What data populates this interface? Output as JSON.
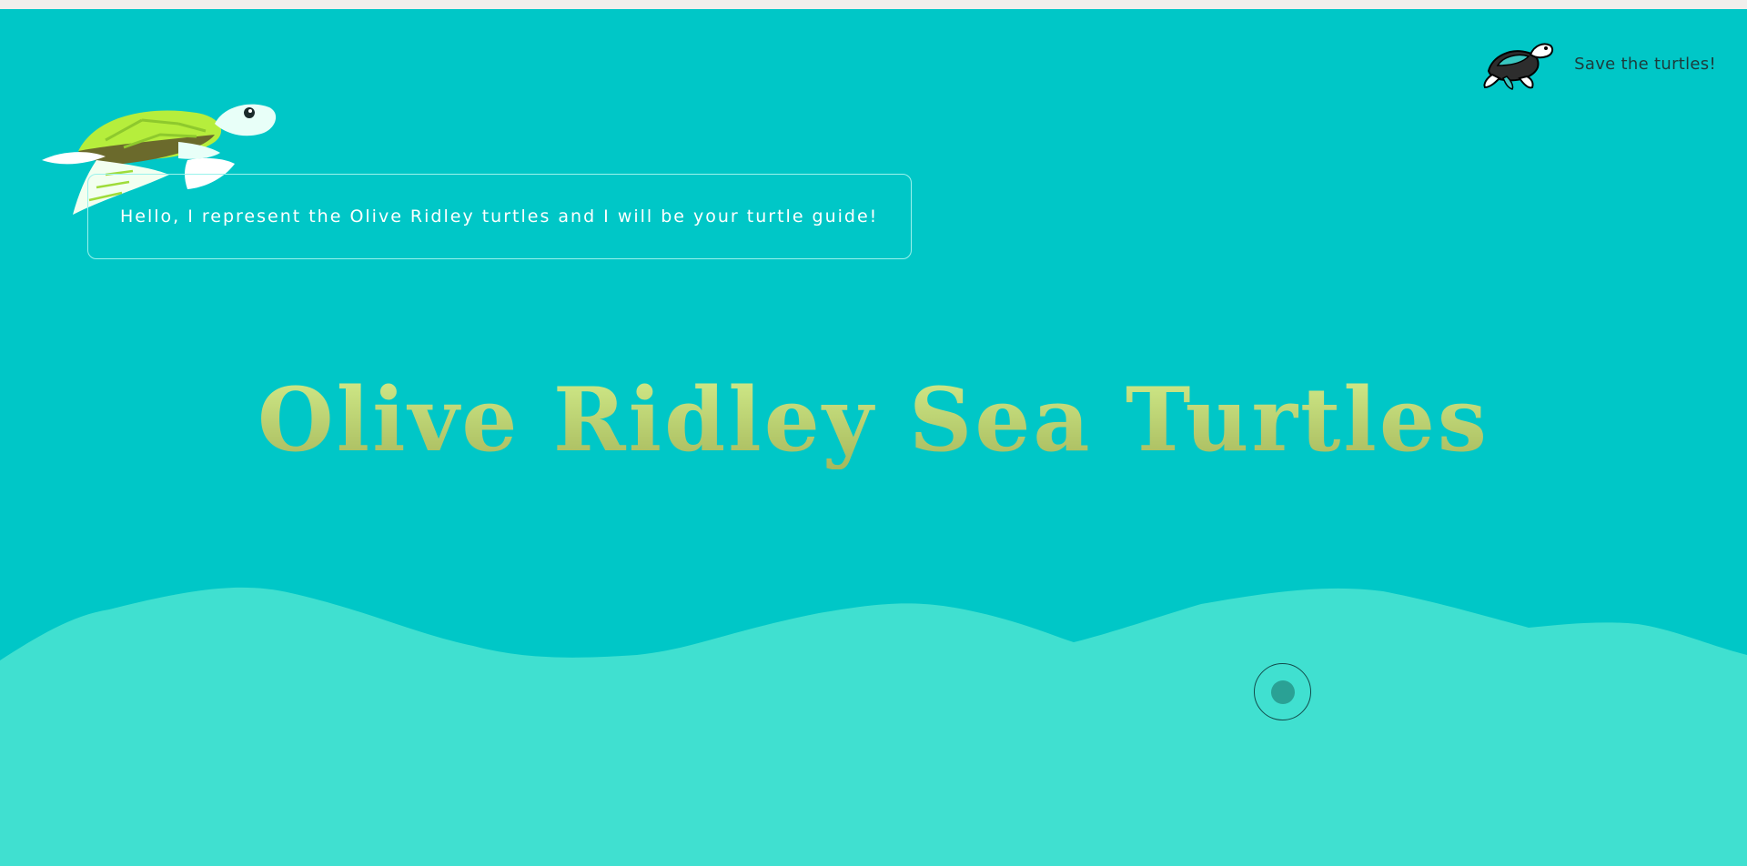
{
  "header": {
    "brand_text": "Save the turtles!",
    "brand_icon": "turtle-logo-icon"
  },
  "guide": {
    "icon": "sea-turtle-icon",
    "message": "Hello, I represent the Olive Ridley turtles and I will be your turtle guide!"
  },
  "hero": {
    "title": "Olive Ridley Sea Turtles"
  },
  "colors": {
    "background": "#00c7c7",
    "wave": "#40e0d0",
    "title_top": "#d2ec8a",
    "title_bottom": "#a6b85c",
    "speech_border": "#9af2ec",
    "orb_dot": "#2aa195"
  }
}
